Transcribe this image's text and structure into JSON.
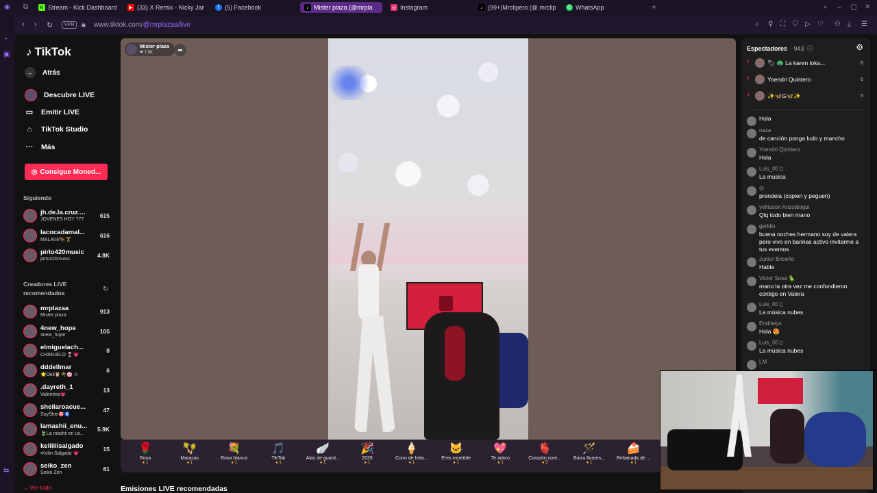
{
  "tabs": [
    {
      "label": "Stream - Kick Dashboard",
      "color": "#53fc18"
    },
    {
      "label": "(33) X Remix - Nicky Jam",
      "color": "#ff0000"
    },
    {
      "label": "(5) Facebook",
      "color": "#1877f2"
    },
    {
      "label": "Mister plaza (@mrpla",
      "color": "#ffffff",
      "active": true
    },
    {
      "label": "Instagram",
      "color": "#e1306c"
    },
    {
      "label": "(99+)Mrclipero (@.mrclip",
      "color": "#ffffff"
    },
    {
      "label": "WhatsApp",
      "color": "#25d366"
    }
  ],
  "address": {
    "vpn": "VPN",
    "url_prefix": "www.tiktok.com/",
    "url_path": "@mrplazaa/live"
  },
  "sidebar": {
    "logo": "TikTok",
    "back": "Atrás",
    "nav": [
      "Descubre LIVE",
      "Emitir LIVE",
      "TikTok Studio",
      "Más"
    ],
    "coins_button": "Consigue Moned...",
    "following_title": "Siguiendo",
    "following": [
      {
        "name": "jh.de.la.cruz....",
        "sub": "JÓVENES HOY 777",
        "count": "615"
      },
      {
        "name": "lacocadamal...",
        "sub": "MALAVE🐂🏋",
        "count": "616"
      },
      {
        "name": "pirlo420music",
        "sub": "pirlo420music",
        "count": "4.8K"
      }
    ],
    "recommended_title_1": "Creadores LIVE",
    "recommended_title_2": "recomendados",
    "recommended": [
      {
        "name": "mrplazaa",
        "sub": "Mister plaza",
        "count": "913"
      },
      {
        "name": "4new_hope",
        "sub": "4new_hope",
        "count": "105"
      },
      {
        "name": "elmiguelach...",
        "sub": "CHIMUELO 🍷💗",
        "count": "8"
      },
      {
        "name": "dddellmar",
        "sub": "⭐Deli🦉🌴🌸 ♾",
        "count": "6"
      },
      {
        "name": ".dayreth_1",
        "sub": "Valentina💗",
        "count": "13"
      },
      {
        "name": "sheilaroacue...",
        "sub": "SoyShei🎯🧿",
        "count": "47"
      },
      {
        "name": "lamashii_enu...",
        "sub": "🍃La mashii en us...",
        "count": "5.9K"
      },
      {
        "name": "keliiiiisalgado",
        "sub": "•Kelin Salgado 💗",
        "count": "15"
      },
      {
        "name": "seiko_zen",
        "sub": "Seiko Zen",
        "count": "81"
      }
    ],
    "see_all": "Ver todo"
  },
  "stream": {
    "host_name": "Mister plaza",
    "host_likes": "7.5K"
  },
  "gifts": [
    {
      "label": "Rosa",
      "icon": "🌹",
      "price": "1"
    },
    {
      "label": "Maracas",
      "icon": "🪇",
      "price": "1"
    },
    {
      "label": "Rosa blanca",
      "icon": "💐",
      "price": "1"
    },
    {
      "label": "TikTok",
      "icon": "🎵",
      "price": "1"
    },
    {
      "label": "Alas de guard...",
      "icon": "🪽",
      "price": "1"
    },
    {
      "label": "2026",
      "icon": "🎉",
      "price": "1"
    },
    {
      "label": "Cono de hela...",
      "icon": "🍦",
      "price": "1"
    },
    {
      "label": "Eres increíble",
      "icon": "🐱",
      "price": "1"
    },
    {
      "label": "Te adoro",
      "icon": "💖",
      "price": "1"
    },
    {
      "label": "Corazón core...",
      "icon": "🫀",
      "price": "5"
    },
    {
      "label": "Barra fluores...",
      "icon": "🪄",
      "price": "1"
    },
    {
      "label": "Rebanada de ...",
      "icon": "🍰",
      "price": "1"
    }
  ],
  "recommended_lives": "Emisiones LIVE recomendadas",
  "chat": {
    "title": "Espectadores",
    "viewers": "· 943",
    "ranking": [
      {
        "n": "1",
        "name": "🏷 🦚 La karen loka...",
        "score": "6"
      },
      {
        "n": "2",
        "name": "Yoendri Quintero",
        "score": "6"
      },
      {
        "n": "3",
        "name": "✨🦋G🦋✨",
        "score": "5"
      }
    ],
    "messages": [
      {
        "user": "",
        "text": "Hola"
      },
      {
        "user": "naza",
        "text": "de canción ponga ludo y mancho"
      },
      {
        "user": "Yoendri Quintero",
        "text": "Hola"
      },
      {
        "user": "Luis_00 ▯",
        "text": "La musica"
      },
      {
        "user": "◎",
        "text": "prendela (copien y peguen)"
      },
      {
        "user": "yehisson Anzoátegui",
        "text": "Qlq todo bien mano"
      },
      {
        "user": "gerklin",
        "text": "buena noches hermano soy de valera pero vivo en barinas activo invitarme a tus eventos"
      },
      {
        "user": "Junior Briceño",
        "text": "Hable"
      },
      {
        "user": "Victor Sosa 🦜",
        "text": "mano la otra vez me confundieron contigo en Valera"
      },
      {
        "user": "Luis_00 ▯",
        "text": "La música nubes"
      },
      {
        "user": "Endrielys",
        "text": "Hola 😍"
      },
      {
        "user": "Luis_00 ▯",
        "text": "La música nubes"
      },
      {
        "user": "LM",
        "text": ""
      }
    ]
  }
}
